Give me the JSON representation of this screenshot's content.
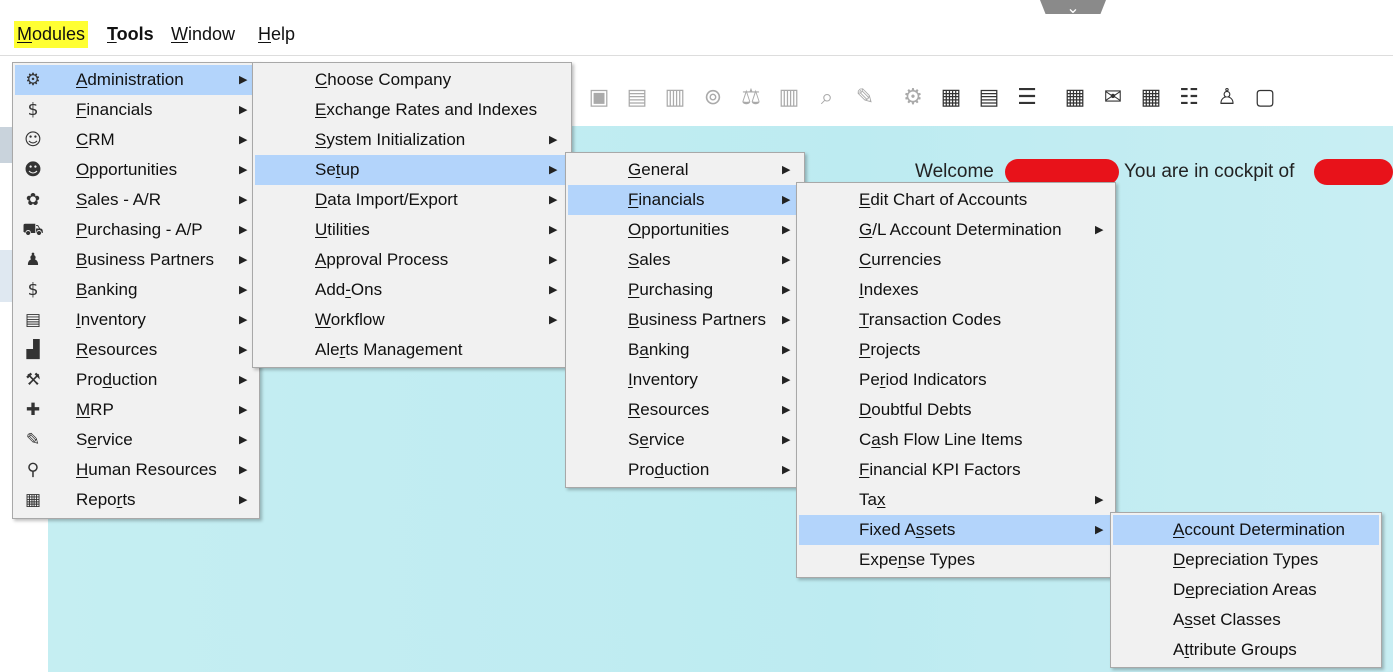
{
  "menubar": {
    "items": [
      {
        "label": "Modules",
        "key": "M",
        "rest": "odules"
      },
      {
        "label": "Tools",
        "key": "T",
        "rest": "ools"
      },
      {
        "label": "Window",
        "key": "W",
        "rest": "indow"
      },
      {
        "label": "Help",
        "key": "H",
        "rest": "elp"
      }
    ]
  },
  "welcome": {
    "left": "Welcome",
    "right": "You are in cockpit of"
  },
  "modules_menu": [
    {
      "pre": "",
      "key": "A",
      "post": "dministration",
      "icon": "administration-icon",
      "glyph": "⚙",
      "submenu": true
    },
    {
      "pre": "",
      "key": "F",
      "post": "inancials",
      "icon": "financials-icon",
      "glyph": "$",
      "submenu": true
    },
    {
      "pre": "",
      "key": "C",
      "post": "RM",
      "icon": "crm-icon",
      "glyph": "☺",
      "submenu": true
    },
    {
      "pre": "",
      "key": "O",
      "post": "pportunities",
      "icon": "opportunities-icon",
      "glyph": "☻",
      "submenu": true
    },
    {
      "pre": "",
      "key": "S",
      "post": "ales - A/R",
      "icon": "sales-icon",
      "glyph": "✿",
      "submenu": true
    },
    {
      "pre": "",
      "key": "P",
      "post": "urchasing - A/P",
      "icon": "purchasing-cart-icon",
      "glyph": "⛟",
      "submenu": true
    },
    {
      "pre": "",
      "key": "B",
      "post": "usiness Partners",
      "icon": "business-partners-icon",
      "glyph": "♟",
      "submenu": true
    },
    {
      "pre": "",
      "key": "B",
      "post": "anking",
      "icon": "banking-dollar-icon",
      "glyph": "$",
      "submenu": true
    },
    {
      "pre": "",
      "key": "I",
      "post": "nventory",
      "icon": "inventory-icon",
      "glyph": "▤",
      "submenu": true
    },
    {
      "pre": "",
      "key": "R",
      "post": "esources",
      "icon": "resources-factory-icon",
      "glyph": "▟",
      "submenu": true
    },
    {
      "pre": "Pro",
      "key": "d",
      "post": "uction",
      "icon": "production-icon",
      "glyph": "⚒",
      "submenu": true
    },
    {
      "pre": "",
      "key": "M",
      "post": "RP",
      "icon": "mrp-puzzle-icon",
      "glyph": "✚",
      "submenu": true
    },
    {
      "pre": "S",
      "key": "e",
      "post": "rvice",
      "icon": "service-icon",
      "glyph": "✎",
      "submenu": true
    },
    {
      "pre": "",
      "key": "H",
      "post": "uman Resources",
      "icon": "human-resources-icon",
      "glyph": "⚲",
      "submenu": true
    },
    {
      "pre": "Repo",
      "key": "r",
      "post": "ts",
      "icon": "reports-icon",
      "glyph": "▦",
      "submenu": true
    }
  ],
  "administration_menu": [
    {
      "pre": "",
      "key": "C",
      "post": "hoose Company",
      "submenu": false
    },
    {
      "pre": "",
      "key": "E",
      "post": "xchange Rates and Indexes",
      "submenu": false
    },
    {
      "pre": "",
      "key": "S",
      "post": "ystem Initialization",
      "submenu": true
    },
    {
      "pre": "Se",
      "key": "t",
      "post": "up",
      "submenu": true
    },
    {
      "pre": "",
      "key": "D",
      "post": "ata Import/Export",
      "submenu": true
    },
    {
      "pre": "",
      "key": "U",
      "post": "tilities",
      "submenu": true
    },
    {
      "pre": "",
      "key": "A",
      "post": "pproval Process",
      "submenu": true
    },
    {
      "pre": "Add",
      "key": "-",
      "post": "Ons",
      "submenu": true
    },
    {
      "pre": "",
      "key": "W",
      "post": "orkflow",
      "submenu": true
    },
    {
      "pre": "Ale",
      "key": "r",
      "post": "ts Management",
      "submenu": false
    }
  ],
  "setup_menu": [
    {
      "pre": "",
      "key": "G",
      "post": "eneral",
      "submenu": true
    },
    {
      "pre": "",
      "key": "F",
      "post": "inancials",
      "submenu": true
    },
    {
      "pre": "",
      "key": "O",
      "post": "pportunities",
      "submenu": true
    },
    {
      "pre": "",
      "key": "S",
      "post": "ales",
      "submenu": true
    },
    {
      "pre": "",
      "key": "P",
      "post": "urchasing",
      "submenu": true
    },
    {
      "pre": "",
      "key": "B",
      "post": "usiness Partners",
      "submenu": true
    },
    {
      "pre": "B",
      "key": "a",
      "post": "nking",
      "submenu": true
    },
    {
      "pre": "",
      "key": "I",
      "post": "nventory",
      "submenu": true
    },
    {
      "pre": "",
      "key": "R",
      "post": "esources",
      "submenu": true
    },
    {
      "pre": "S",
      "key": "e",
      "post": "rvice",
      "submenu": true
    },
    {
      "pre": "Pro",
      "key": "d",
      "post": "uction",
      "submenu": true
    }
  ],
  "financials_menu": [
    {
      "pre": "",
      "key": "E",
      "post": "dit Chart of Accounts",
      "submenu": false
    },
    {
      "pre": "",
      "key": "G",
      "post": "/L Account Determination",
      "submenu": true
    },
    {
      "pre": "",
      "key": "C",
      "post": "urrencies",
      "submenu": false
    },
    {
      "pre": "",
      "key": "I",
      "post": "ndexes",
      "submenu": false
    },
    {
      "pre": "",
      "key": "T",
      "post": "ransaction Codes",
      "submenu": false
    },
    {
      "pre": "",
      "key": "P",
      "post": "rojects",
      "submenu": false
    },
    {
      "pre": "Pe",
      "key": "r",
      "post": "iod Indicators",
      "submenu": false
    },
    {
      "pre": "",
      "key": "D",
      "post": "oubtful Debts",
      "submenu": false
    },
    {
      "pre": "C",
      "key": "a",
      "post": "sh Flow Line Items",
      "submenu": false
    },
    {
      "pre": "",
      "key": "F",
      "post": "inancial KPI Factors",
      "submenu": false
    },
    {
      "pre": "Ta",
      "key": "x",
      "post": "",
      "submenu": true
    },
    {
      "pre": "Fixed A",
      "key": "s",
      "post": "sets",
      "submenu": true
    },
    {
      "pre": "Expe",
      "key": "n",
      "post": "se Types",
      "submenu": false
    }
  ],
  "fixed_assets_menu": [
    {
      "pre": "",
      "key": "A",
      "post": "ccount Determination",
      "submenu": false
    },
    {
      "pre": "",
      "key": "D",
      "post": "epreciation Types",
      "submenu": false
    },
    {
      "pre": "D",
      "key": "e",
      "post": "preciation Areas",
      "submenu": false
    },
    {
      "pre": "A",
      "key": "s",
      "post": "set Classes",
      "submenu": false
    },
    {
      "pre": "A",
      "key": "t",
      "post": "tribute Groups",
      "submenu": false
    }
  ],
  "toolbar_icons": [
    "form-icon",
    "form2-icon",
    "document-icon",
    "currency-icon",
    "balance-icon",
    "ledger-icon",
    "report-icon",
    "edit-icon",
    "settings-doc-icon",
    "edit-doc-icon",
    "message-icon",
    "message2-icon",
    "calendar-form-icon",
    "mail-icon",
    "calculator-icon",
    "org-chart-icon",
    "user-icon",
    "window-icon"
  ],
  "colors": {
    "highlight": "#ffff33",
    "selected": "#b3d4fb",
    "cockpit": "#bdebf1",
    "redact": "#e8121a"
  }
}
